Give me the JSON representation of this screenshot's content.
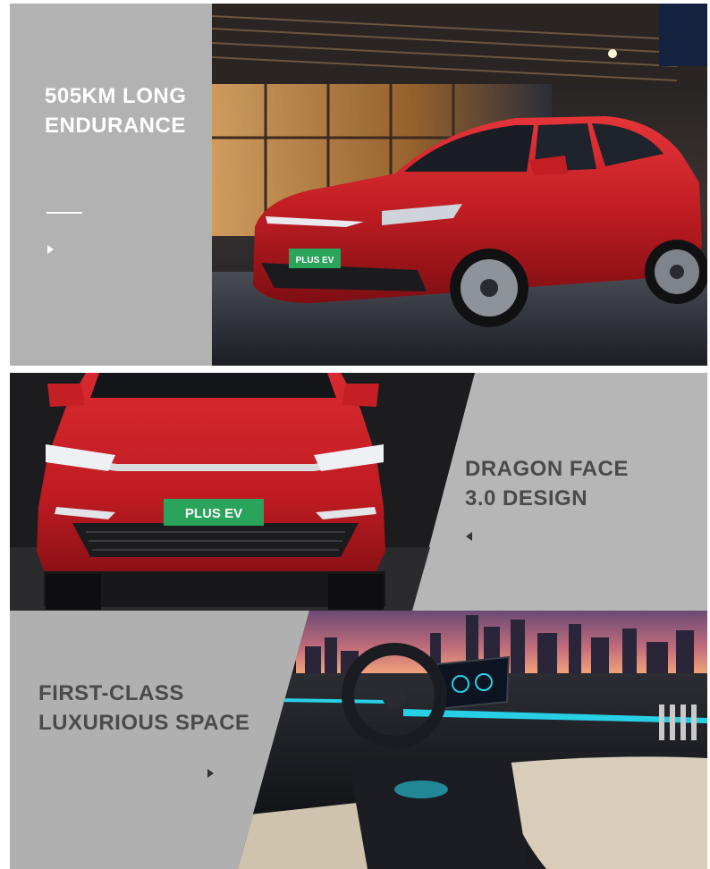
{
  "colors": {
    "panel_gray": "#b4b4b4",
    "car_red": "#c51f24",
    "plate_green": "#2aa35b",
    "ambient_cyan": "#27d0e6"
  },
  "section1": {
    "title_line1": "505KM LONG",
    "title_line2": "ENDURANCE",
    "plate_text": "PLUS EV",
    "arrow_icon": "play-right-icon"
  },
  "section2": {
    "title_line1": "DRAGON FACE",
    "title_line2": "3.0 DESIGN",
    "plate_text": "PLUS EV",
    "arrow_icon": "play-left-icon"
  },
  "section3": {
    "title_line1": "FIRST-CLASS",
    "title_line2": "LUXURIOUS SPACE",
    "arrow_icon": "play-right-icon"
  }
}
